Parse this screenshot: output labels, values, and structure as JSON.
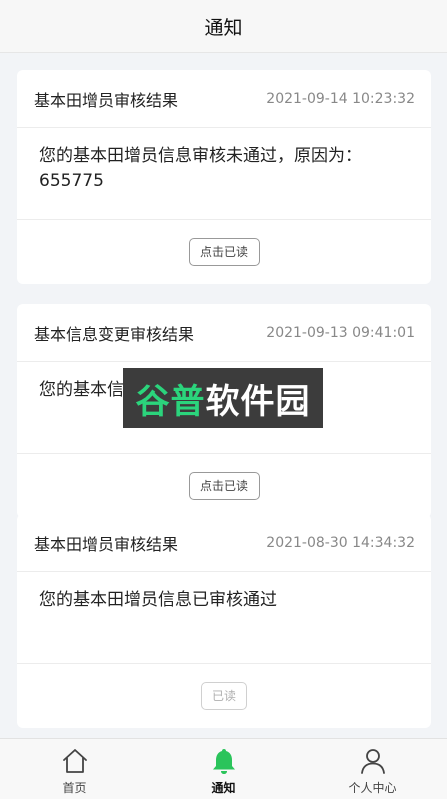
{
  "header": {
    "title": "通知"
  },
  "notifications": [
    {
      "title": "基本田增员审核结果",
      "time": "2021-09-14 10:23:32",
      "message": "您的基本田增员信息审核未通过，原因为：655775",
      "action_label": "点击已读",
      "read": false
    },
    {
      "title": "基本信息变更审核结果",
      "time": "2021-09-13 09:41:01",
      "message": "您的基本信",
      "action_label": "点击已读",
      "read": false
    },
    {
      "title": "基本田增员审核结果",
      "time": "2021-08-30 14:34:32",
      "message": "您的基本田增员信息已审核通过",
      "action_label": "已读",
      "read": true
    }
  ],
  "watermark": {
    "text_green": "谷普",
    "text_white": "软件园",
    "color_green": "#2bd47c",
    "color_white": "#ffffff"
  },
  "tabbar": {
    "items": [
      {
        "label": "首页",
        "icon": "home-icon"
      },
      {
        "label": "通知",
        "icon": "bell-icon",
        "active": true
      },
      {
        "label": "个人中心",
        "icon": "user-icon"
      }
    ],
    "active_color": "#2bc45b"
  }
}
